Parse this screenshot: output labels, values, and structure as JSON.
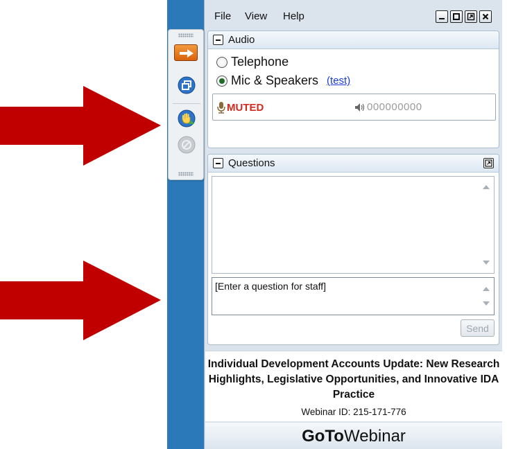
{
  "menu": {
    "file": "File",
    "view": "View",
    "help": "Help"
  },
  "window_buttons": [
    "minimize-icon",
    "maximize-icon",
    "popout-icon",
    "close-icon"
  ],
  "audio": {
    "title": "Audio",
    "options": [
      {
        "label": "Telephone",
        "selected": false
      },
      {
        "label": "Mic & Speakers",
        "selected": true
      }
    ],
    "test_link": "(test)",
    "status": "MUTED",
    "level_text": "000000000"
  },
  "questions": {
    "title": "Questions",
    "input_placeholder": "[Enter a question for staff]",
    "send_label": "Send"
  },
  "webinar": {
    "title": "Individual Development Accounts Update: New Research Highlights, Legislative Opportunities, and Innovative IDA Practice",
    "id_line": "Webinar ID: 215-171-776"
  },
  "brand": {
    "bold": "GoTo",
    "regular": "Webinar"
  },
  "colors": {
    "arrow": "#c00000",
    "frame_blue": "#2b79b9",
    "muted_red": "#d12a1f",
    "link_blue": "#1a3ccf"
  },
  "toolbar_icons": [
    "arrow-toggle-icon",
    "window-popout-icon",
    "raise-hand-icon",
    "disabled-icon"
  ]
}
